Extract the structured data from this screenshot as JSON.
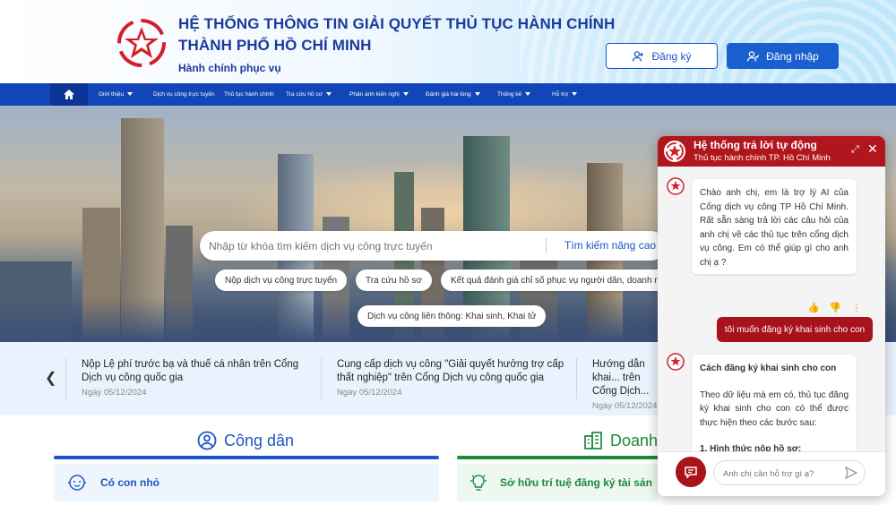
{
  "header": {
    "title_line1": "HỆ THỐNG THÔNG TIN GIẢI QUYẾT THỦ TỤC HÀNH CHÍNH",
    "title_line2": "THÀNH PHỐ HỒ CHÍ MINH",
    "subtitle": "Hành chính phục vụ",
    "register_label": "Đăng ký",
    "login_label": "Đăng nhập"
  },
  "nav": {
    "items": [
      {
        "label": "Giới thiệu"
      },
      {
        "label": "Dịch vụ công trực tuyến"
      },
      {
        "label": "Thủ tục hành chính"
      },
      {
        "label": "Tra cứu hồ sơ"
      },
      {
        "label": "Phản ánh kiến nghị"
      },
      {
        "label": "Đánh giá hài lòng"
      },
      {
        "label": "Thống kê"
      },
      {
        "label": "Hỗ trợ"
      }
    ]
  },
  "search": {
    "placeholder": "Nhập từ khóa tìm kiếm dịch vụ công trực tuyến",
    "advanced_label": "Tìm kiếm nâng cao"
  },
  "quick_links": [
    "Nộp dịch vụ công trực tuyến",
    "Tra cứu hồ sơ",
    "Kết quả đánh giá chỉ số phục vụ người dân, doanh nghiệp",
    "Dịch vụ công liên thông: Khai sinh, Khai tử"
  ],
  "news": [
    {
      "title": "Nộp Lệ phí trước bạ và thuế cá nhân trên Cổng Dịch vụ công quốc gia",
      "date": "Ngày 05/12/2024"
    },
    {
      "title": "Cung cấp dịch vụ công \"Giải quyết hưởng trợ cấp thất nghiệp\" trên Cổng Dịch vụ công quốc gia",
      "date": "Ngày 05/12/2024"
    },
    {
      "title": "Hướng dẫn khai... trên Cổng Dịch...",
      "date": "Ngày 05/12/2024"
    }
  ],
  "sections": {
    "citizen_title": "Công dân",
    "business_title": "Doanh",
    "citizen_card": "Có con nhỏ",
    "business_card": "Sở hữu trí tuệ đăng ký tài sản"
  },
  "chat": {
    "title": "Hệ thống trả lời tự động",
    "subtitle": "Thủ tục hành chính TP. Hồ Chí Minh",
    "greeting": "Chào anh chị, em là trợ lý AI của Cổng dịch vụ công TP Hồ Chí Minh. Rất sẵn sàng trả lời các câu hỏi của anh chị về các thủ tục trên cổng dịch vụ công. Em có thể giúp gì cho anh chị ạ ?",
    "user_message": "tôi muốn đăng ký khai sinh cho con",
    "answer_title": "Cách đăng ký khai sinh cho con",
    "answer_body": "Theo dữ liệu mà em có, thủ tục đăng ký khai sinh cho con có thể được thực hiện theo các bước sau:",
    "answer_step": "1. Hình thức nộp hồ sơ:",
    "input_placeholder": "Anh chị cần hỗ trợ gì ạ?"
  },
  "colors": {
    "primary_blue": "#1a56c9",
    "nav_blue": "#1246b8",
    "chat_red": "#b1161f",
    "green": "#1a8a3c"
  }
}
